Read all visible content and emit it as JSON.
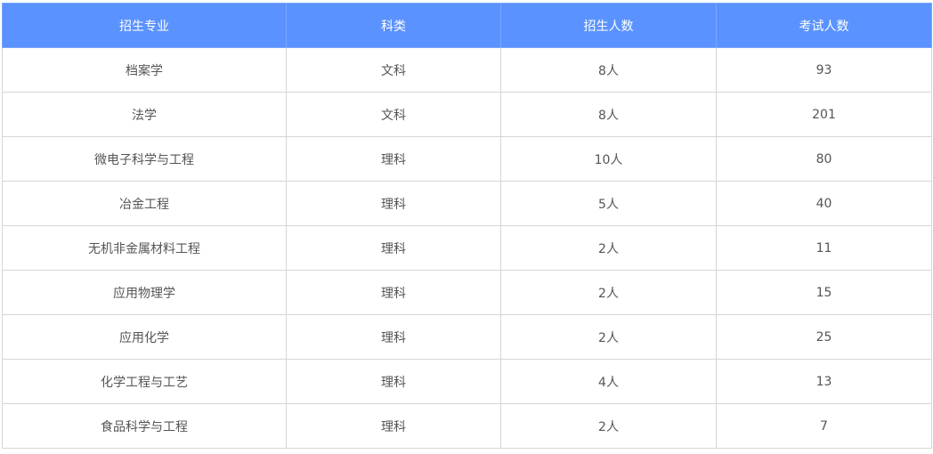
{
  "table": {
    "headers": [
      "招生专业",
      "科类",
      "招生人数",
      "考试人数"
    ],
    "rows": [
      [
        "档案学",
        "文科",
        "8人",
        "93"
      ],
      [
        "法学",
        "文科",
        "8人",
        "201"
      ],
      [
        "微电子科学与工程",
        "理科",
        "10人",
        "80"
      ],
      [
        "冶金工程",
        "理科",
        "5人",
        "40"
      ],
      [
        "无机非金属材料工程",
        "理科",
        "2人",
        "11"
      ],
      [
        "应用物理学",
        "理科",
        "2人",
        "15"
      ],
      [
        "应用化学",
        "理科",
        "2人",
        "25"
      ],
      [
        "化学工程与工艺",
        "理科",
        "4人",
        "13"
      ],
      [
        "食品科学与工程",
        "理科",
        "2人",
        "7"
      ]
    ]
  },
  "colors": {
    "header_bg": "#5a93ff",
    "header_text": "#ffffff",
    "cell_text": "#555555",
    "border": "#d6d6d6"
  }
}
